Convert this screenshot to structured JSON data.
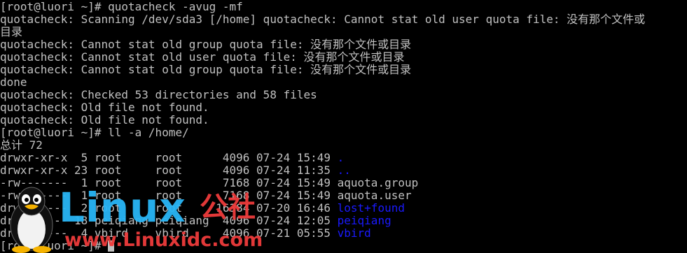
{
  "terminal": {
    "lines": [
      [
        {
          "t": "[root@luori ~]# quotacheck -avug -mf"
        }
      ],
      [
        {
          "t": "quotacheck: Scanning /dev/sda3 [/home] quotacheck: Cannot stat old user quota file: 没有那个文件或"
        }
      ],
      [
        {
          "t": "目录"
        }
      ],
      [
        {
          "t": "quotacheck: Cannot stat old group quota file: 没有那个文件或目录"
        }
      ],
      [
        {
          "t": "quotacheck: Cannot stat old user quota file: 没有那个文件或目录"
        }
      ],
      [
        {
          "t": "quotacheck: Cannot stat old group quota file: 没有那个文件或目录"
        }
      ],
      [
        {
          "t": "done"
        }
      ],
      [
        {
          "t": "quotacheck: Checked 53 directories and 58 files"
        }
      ],
      [
        {
          "t": "quotacheck: Old file not found."
        }
      ],
      [
        {
          "t": "quotacheck: Old file not found."
        }
      ],
      [
        {
          "t": "[root@luori ~]# ll -a /home/"
        }
      ],
      [
        {
          "t": "总计 72"
        }
      ],
      [
        {
          "t": "drwxr-xr-x  5 root     root      4096 07-24 15:49 "
        },
        {
          "t": ".",
          "c": "blue"
        }
      ],
      [
        {
          "t": "drwxr-xr-x 23 root     root      4096 07-24 11:35 "
        },
        {
          "t": "..",
          "c": "blue"
        }
      ],
      [
        {
          "t": "-rw-------  1 root     root      7168 07-24 15:49 aquota.group"
        }
      ],
      [
        {
          "t": "-rw-------  1 root     root      7168 07-24 15:49 aquota.user"
        }
      ],
      [
        {
          "t": "drwx------  2 root     root     16384 07-20 16:46 "
        },
        {
          "t": "lost+found",
          "c": "blue"
        }
      ],
      [
        {
          "t": "drwx------ 18 peiqiang peiqiang  4096 07-24 12:05 "
        },
        {
          "t": "peiqiang",
          "c": "blue"
        }
      ],
      [
        {
          "t": "drwx------  4 vbird    vbird     4096 07-21 05:55 "
        },
        {
          "t": "vbird",
          "c": "blue"
        }
      ],
      [
        {
          "t": "[root@luori ~]# "
        }
      ]
    ],
    "colors": {
      "background": "#000000",
      "foreground": "#c0c0c0",
      "directory": "#1a1aff"
    }
  },
  "watermark": {
    "logo": "Linux",
    "cn": "公社",
    "url": "www.Linuxidc.com",
    "icon": "tux-penguin-icon",
    "colors": {
      "logo": "#29b6f6",
      "accent": "#ef3b3b"
    }
  }
}
